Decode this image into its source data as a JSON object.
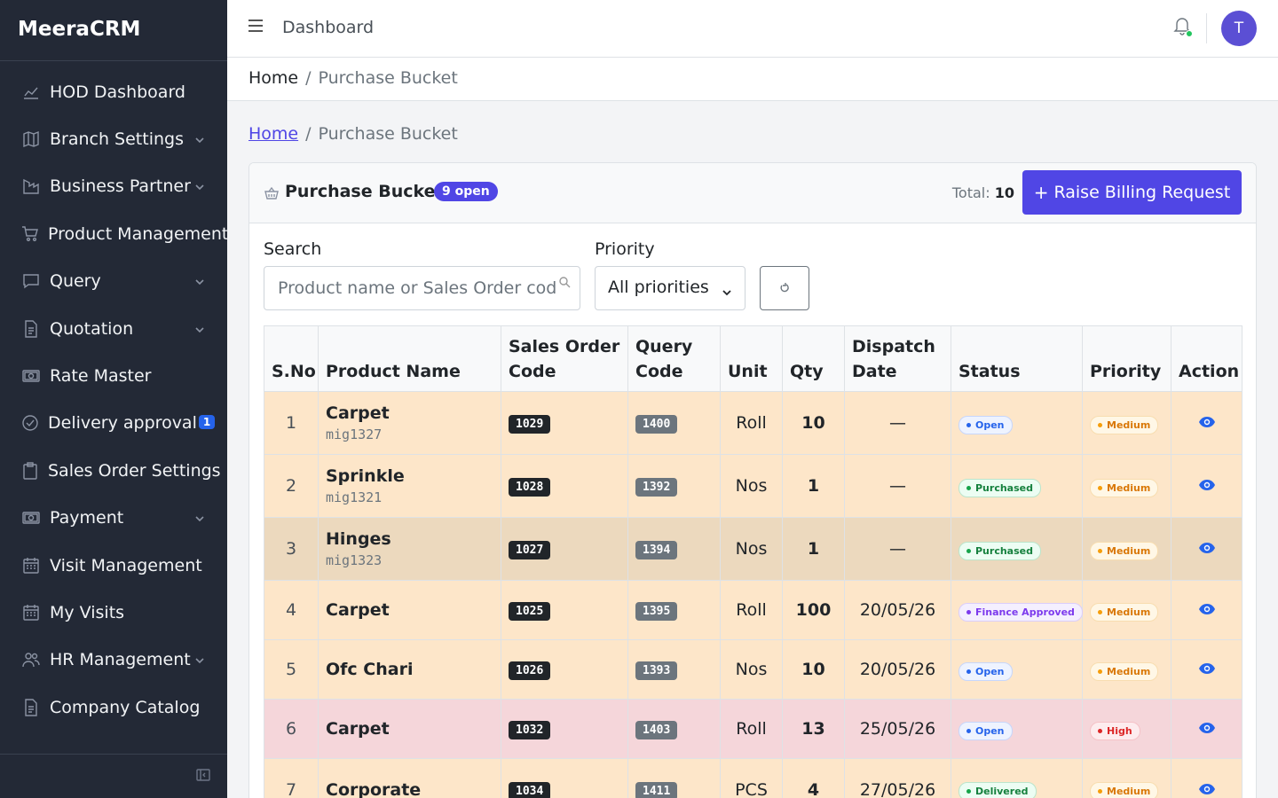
{
  "app": {
    "brand": "MeeraCRM"
  },
  "sidebar": {
    "items": [
      {
        "label": "HOD Dashboard",
        "icon": "chart-line-icon",
        "chevron": false
      },
      {
        "label": "Branch Settings",
        "icon": "map-icon",
        "chevron": true
      },
      {
        "label": "Business Partner",
        "icon": "building-icon",
        "chevron": true
      },
      {
        "label": "Product Management",
        "icon": "cart-icon",
        "chevron": false
      },
      {
        "label": "Query",
        "icon": "chat-icon",
        "chevron": true
      },
      {
        "label": "Quotation",
        "icon": "document-icon",
        "chevron": true
      },
      {
        "label": "Rate Master",
        "icon": "cash-icon",
        "chevron": false
      },
      {
        "label": "Delivery approval",
        "icon": "check-circle-icon",
        "chevron": false,
        "badge": "1"
      },
      {
        "label": "Sales Order Settings",
        "icon": "clipboard-icon",
        "chevron": false
      },
      {
        "label": "Payment",
        "icon": "cash-icon",
        "chevron": true
      },
      {
        "label": "Visit Management",
        "icon": "calendar-icon",
        "chevron": false
      },
      {
        "label": "My Visits",
        "icon": "calendar-icon",
        "chevron": false
      },
      {
        "label": "HR Management",
        "icon": "people-icon",
        "chevron": true
      },
      {
        "label": "Company Catalog",
        "icon": "document-icon",
        "chevron": false
      }
    ]
  },
  "topbar": {
    "title": "Dashboard",
    "avatar_initial": "T"
  },
  "breadcrumb": {
    "home": "Home",
    "separator": "/",
    "current": "Purchase Bucket"
  },
  "card": {
    "title": "Purchase Bucket",
    "open_badge": "9 open",
    "total_label": "Total:",
    "total_value": "10",
    "raise_button": "Raise Billing Request"
  },
  "filters": {
    "search_label": "Search",
    "search_placeholder": "Product name or Sales Order code...",
    "priority_label": "Priority",
    "priority_selected": "All priorities"
  },
  "table": {
    "headers": [
      "S.No",
      "Product Name",
      "Sales Order Code",
      "Query Code",
      "Unit",
      "Qty",
      "Dispatch Date",
      "Status",
      "Priority",
      "Action"
    ],
    "rows": [
      {
        "sno": "1",
        "name": "Carpet",
        "sub": "mig1327",
        "so": "1029",
        "qc": "1400",
        "unit": "Roll",
        "qty": "10",
        "date": "—",
        "status": "Open",
        "priority": "Medium",
        "tone": "orange"
      },
      {
        "sno": "2",
        "name": "Sprinkle",
        "sub": "mig1321",
        "so": "1028",
        "qc": "1392",
        "unit": "Nos",
        "qty": "1",
        "date": "—",
        "status": "Purchased",
        "priority": "Medium",
        "tone": "orange"
      },
      {
        "sno": "3",
        "name": "Hinges",
        "sub": "mig1323",
        "so": "1027",
        "qc": "1394",
        "unit": "Nos",
        "qty": "1",
        "date": "—",
        "status": "Purchased",
        "priority": "Medium",
        "tone": "tan"
      },
      {
        "sno": "4",
        "name": "Carpet",
        "sub": "",
        "so": "1025",
        "qc": "1395",
        "unit": "Roll",
        "qty": "100",
        "date": "20/05/26",
        "status": "Finance Approved",
        "priority": "Medium",
        "tone": "orange"
      },
      {
        "sno": "5",
        "name": "Ofc Chari",
        "sub": "",
        "so": "1026",
        "qc": "1393",
        "unit": "Nos",
        "qty": "10",
        "date": "20/05/26",
        "status": "Open",
        "priority": "Medium",
        "tone": "orange"
      },
      {
        "sno": "6",
        "name": "Carpet",
        "sub": "",
        "so": "1032",
        "qc": "1403",
        "unit": "Roll",
        "qty": "13",
        "date": "25/05/26",
        "status": "Open",
        "priority": "High",
        "tone": "pink"
      },
      {
        "sno": "7",
        "name": "Corporate",
        "sub": "",
        "so": "1034",
        "qc": "1411",
        "unit": "PCS",
        "qty": "4",
        "date": "27/05/26",
        "status": "Delivered",
        "priority": "Medium",
        "tone": "orange"
      }
    ]
  },
  "colors": {
    "accent": "#5046e5",
    "sidebar_bg": "#232936",
    "row_orange": "#fde6c9",
    "row_pink": "#f5d6da"
  }
}
